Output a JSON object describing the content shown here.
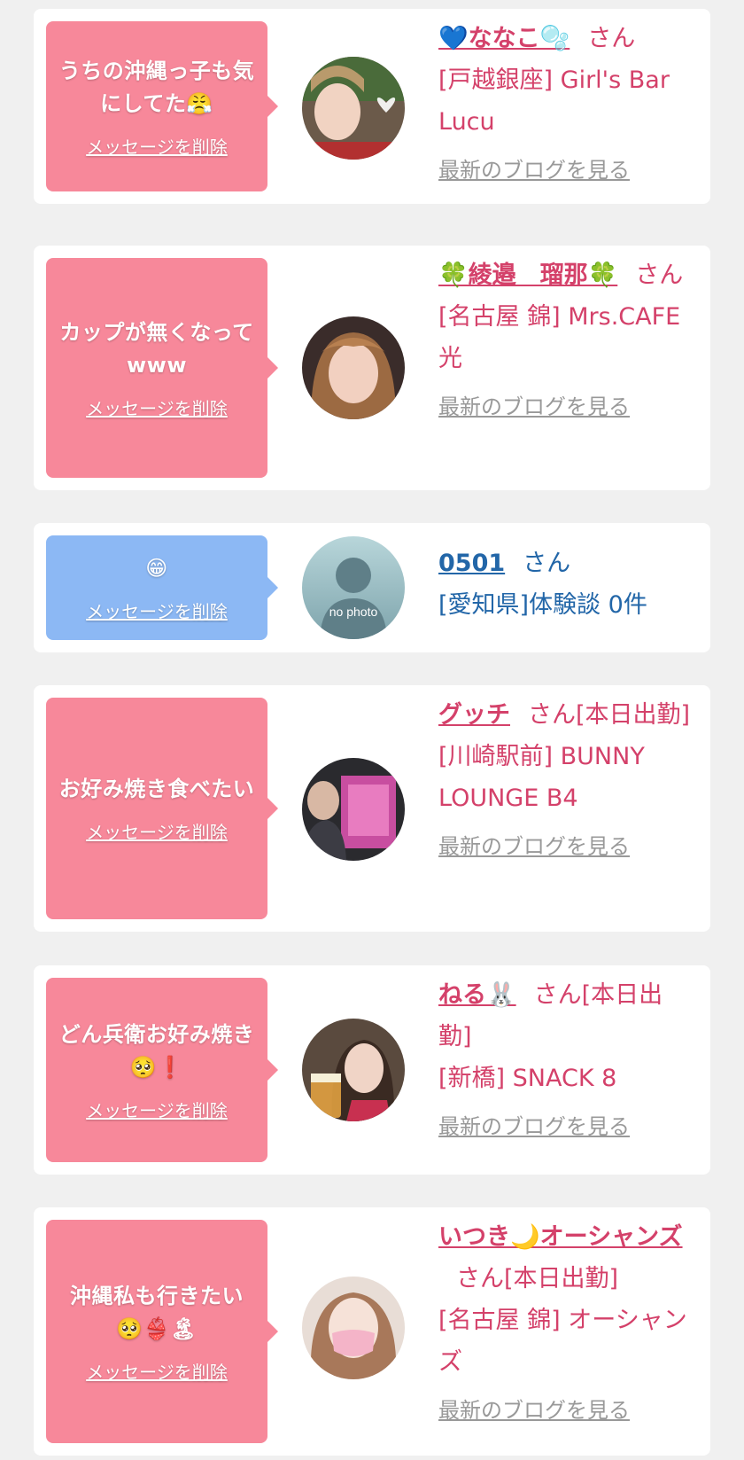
{
  "san_suffix": "さん",
  "delete_label": "メッセージを削除",
  "blog_label": "最新のブログを見る",
  "cards": [
    {
      "message": "うちの沖縄っ子も気にしてた😤",
      "name": "💙ななこ🫧",
      "status": "",
      "shop": "[戸越銀座] Girl's Bar Lucu"
    },
    {
      "message": "カップが無くなってwww",
      "name": "🍀綾邉　瑠那🍀",
      "status": "",
      "shop": "[名古屋 錦] Mrs.CAFE 光"
    },
    {
      "message": "😁",
      "name": "0501",
      "status": "",
      "shop": "[愛知県]体験談 0件",
      "avatar_text": "no photo"
    },
    {
      "message": "お好み焼き食べたい",
      "name": "グッチ",
      "status": "[本日出勤]",
      "shop": "[川崎駅前] BUNNY LOUNGE B4"
    },
    {
      "message": "どん兵衛お好み焼き🥺❗",
      "name": "ねる🐰",
      "status": "[本日出勤]",
      "shop": "[新橋] SNACK 8"
    },
    {
      "message": "沖縄私も行きたい🥺👙🏝",
      "name": "いつき🌙オーシャンズ",
      "status": "[本日出勤]",
      "shop": "[名古屋 錦] オーシャンズ"
    }
  ],
  "colors": {
    "pink_bubble": "#f7889a",
    "blue_bubble": "#8cb8f4",
    "name_pink": "#d4416a",
    "name_blue": "#2266a8",
    "link_gray": "#999999"
  }
}
